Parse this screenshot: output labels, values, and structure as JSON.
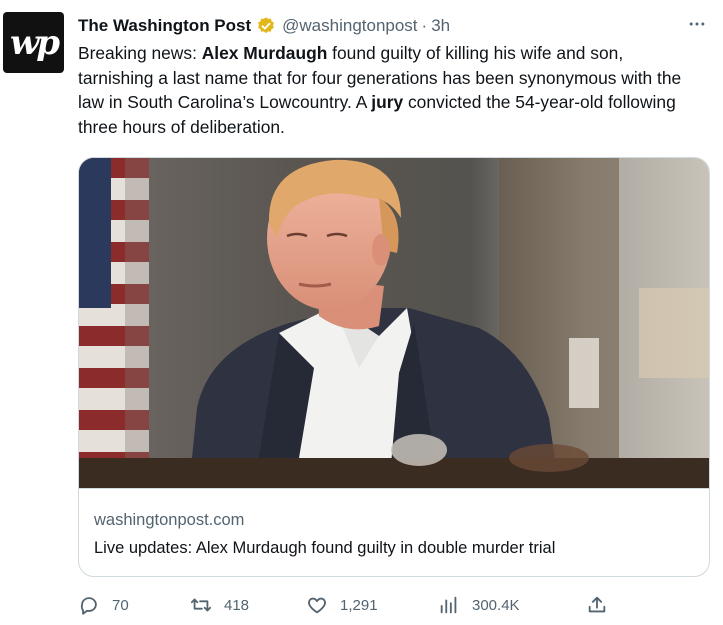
{
  "account": {
    "logo_text": "wp",
    "display_name": "The Washington Post",
    "handle": "@washingtonpost",
    "separator": "·",
    "time": "3h"
  },
  "tweet": {
    "segments": [
      {
        "text": "Breaking news: ",
        "bold": false
      },
      {
        "text": "Alex Murdaugh",
        "bold": true
      },
      {
        "text": " found guilty of killing his wife and son, tarnishing a last name that for four generations has been synonymous with the law in South Carolina’s Lowcountry. A ",
        "bold": false
      },
      {
        "text": "jury",
        "bold": true
      },
      {
        "text": " convicted the 54-year-old following three hours of deliberation.",
        "bold": false
      }
    ]
  },
  "card": {
    "domain": "washingtonpost.com",
    "title": "Live updates: Alex Murdaugh found guilty in double murder trial"
  },
  "actions": {
    "replies": "70",
    "retweets": "418",
    "likes": "1,291",
    "views": "300.4K"
  },
  "colors": {
    "text_primary": "#0f1419",
    "text_secondary": "#536471",
    "verified_badge": "#e2b719",
    "border": "#cfd9de"
  },
  "icons": {
    "more": "more-horizontal-icon",
    "verified": "verified-badge-icon",
    "reply": "reply-icon",
    "retweet": "retweet-icon",
    "like": "like-icon",
    "views": "views-icon",
    "share": "share-icon"
  }
}
